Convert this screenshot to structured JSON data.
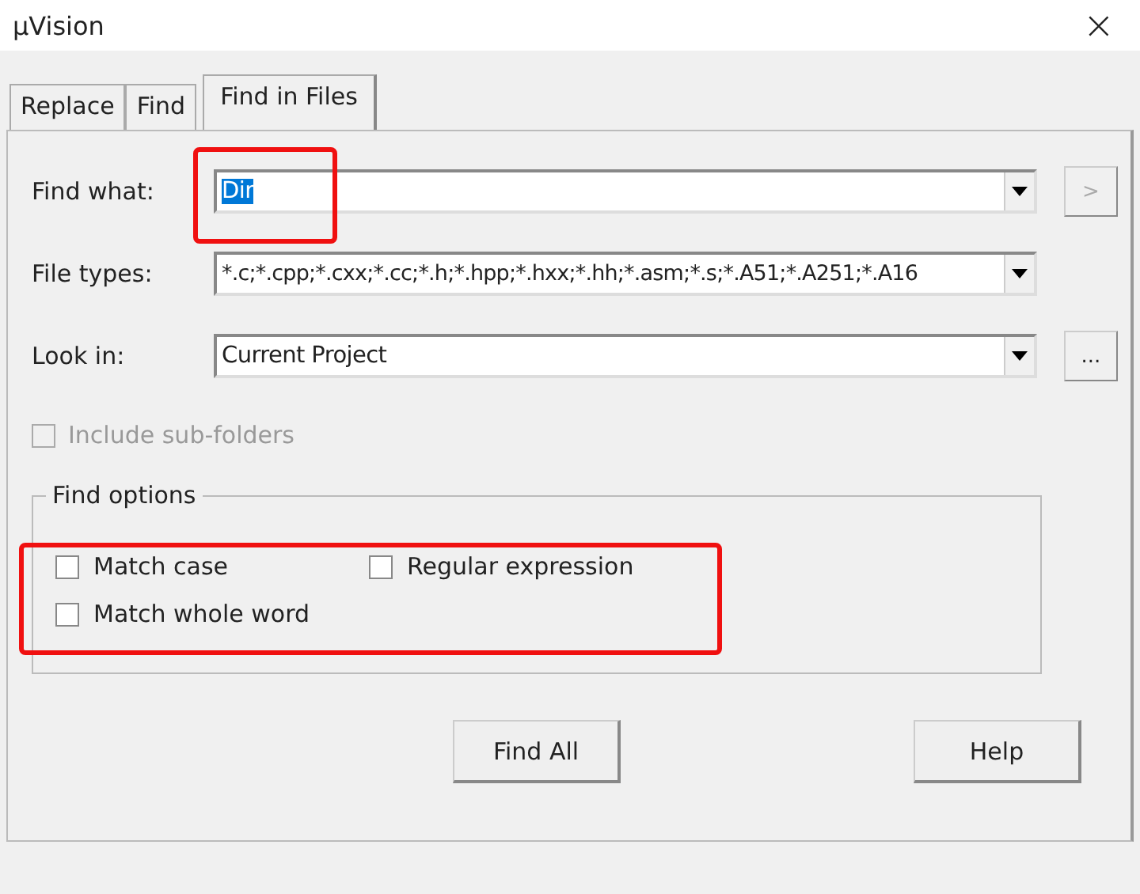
{
  "window": {
    "title": "µVision",
    "close": "×"
  },
  "tabs": [
    {
      "label": "Replace",
      "selected": false
    },
    {
      "label": "Find",
      "selected": false
    },
    {
      "label": "Find in Files",
      "selected": true
    }
  ],
  "fields": [
    {
      "label": "Find what:",
      "value": "Dir",
      "text_selected": true,
      "side_button": ">",
      "side_disabled": true
    },
    {
      "label": "File types:",
      "value": "*.c;*.cpp;*.cxx;*.cc;*.h;*.hpp;*.hxx;*.hh;*.asm;*.s;*.A51;*.A251;*.A16",
      "text_selected": false
    },
    {
      "label": "Look in:",
      "value": "Current Project",
      "text_selected": false,
      "side_button": "...",
      "side_disabled": false
    }
  ],
  "include_subfolders": {
    "label": "Include sub-folders",
    "checked": false,
    "disabled": true
  },
  "find_options": {
    "title": "Find options",
    "options": [
      {
        "label": "Match case",
        "checked": false
      },
      {
        "label": "Regular expression",
        "checked": false
      },
      {
        "label": "Match whole word",
        "checked": false
      }
    ]
  },
  "buttons": [
    {
      "label": "Find All"
    },
    {
      "label": "Help"
    }
  ]
}
